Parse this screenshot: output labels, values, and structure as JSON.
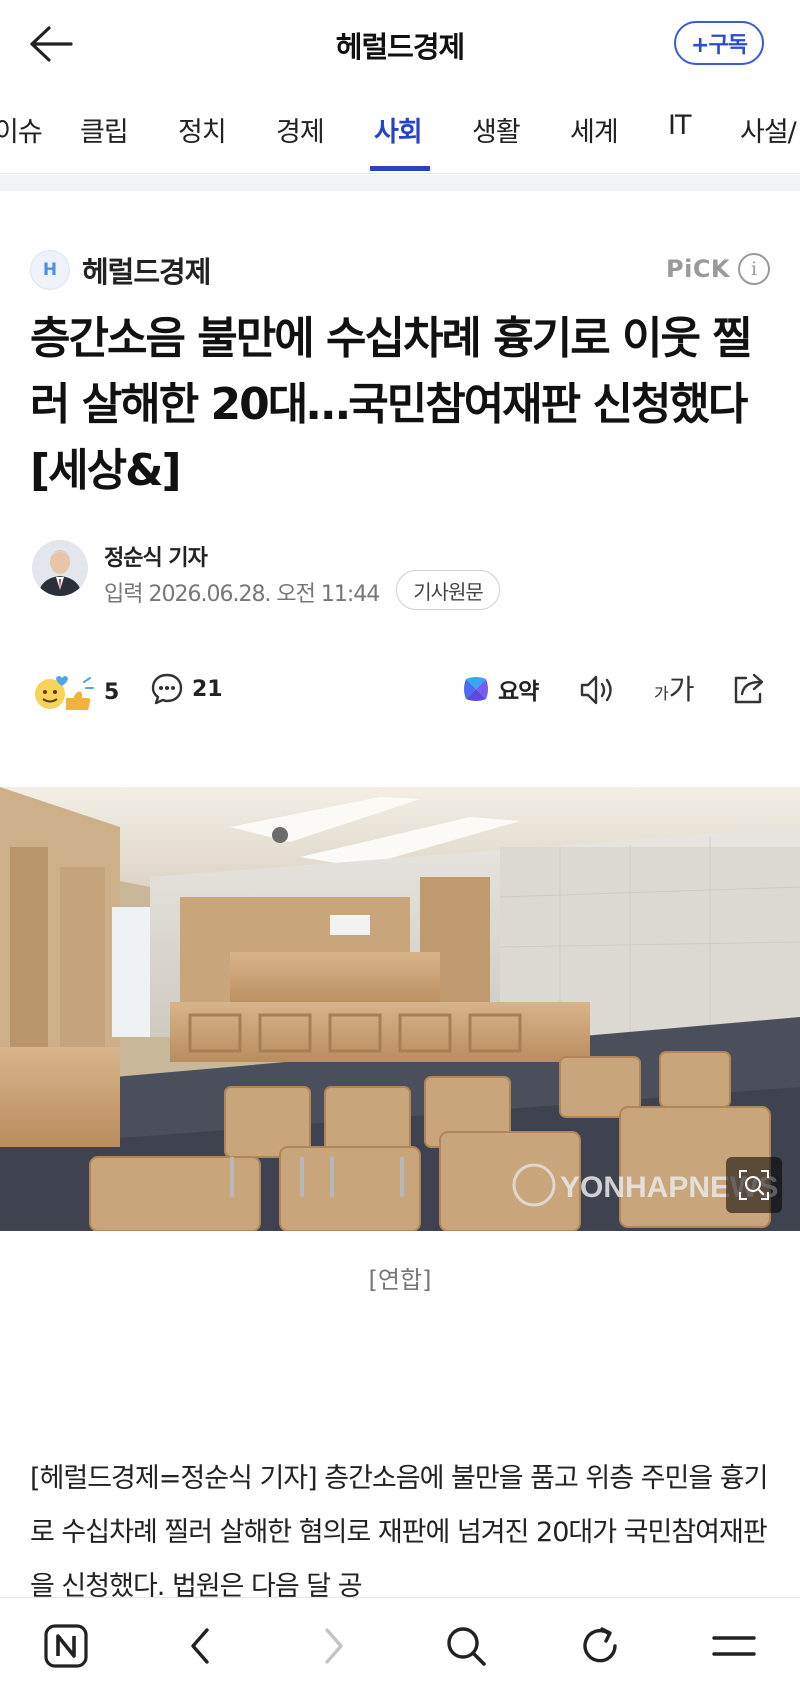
{
  "header": {
    "title": "헤럴드경제",
    "subscribe_label": "+구독"
  },
  "tabs": [
    {
      "label": "이슈"
    },
    {
      "label": "클립"
    },
    {
      "label": "정치"
    },
    {
      "label": "경제"
    },
    {
      "label": "사회",
      "active": true
    },
    {
      "label": "생활"
    },
    {
      "label": "세계"
    },
    {
      "label": "IT"
    },
    {
      "label": "사설/"
    }
  ],
  "press": {
    "logo_letter": "H",
    "name": "헤럴드경제",
    "badge": "PiCK"
  },
  "article": {
    "headline": "층간소음 불만에 수십차례 흉기로 이웃 찔러 살해한 20대…국민참여재판 신청했다 [세상&]",
    "reporter": "정순식 기자",
    "date": "입력 2026.06.28. 오전 11:44",
    "original_label": "기사원문",
    "photo_caption": "[연합]",
    "photo_watermark": "YONHAPNEWS",
    "body": "[헤럴드경제=정순식 기자] 층간소음에 불만을 품고 위층 주민을 흉기로 수십차례 찔러 살해한 혐의로 재판에 넘겨진 20대가 국민참여재판을 신청했다. 법원은 다음 달 공"
  },
  "actions": {
    "reaction_count": "5",
    "comment_count": "21",
    "summary_label": "요약",
    "font_small": "가",
    "font_big": "가"
  },
  "bottom_nav": [
    "naver-home",
    "back",
    "forward",
    "search",
    "refresh",
    "menu"
  ],
  "colors": {
    "accent": "#2744c8",
    "subscribe": "#3b5bdb",
    "muted": "#777777"
  }
}
